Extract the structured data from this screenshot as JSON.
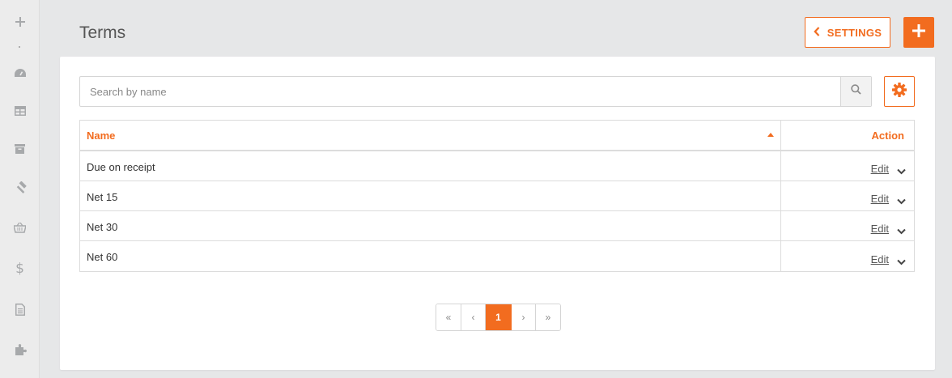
{
  "sidebar": {
    "items": [
      {
        "icon": "plus-icon"
      },
      {
        "icon": "dashboard-icon"
      },
      {
        "icon": "table-icon"
      },
      {
        "icon": "archive-icon"
      },
      {
        "icon": "hammer-icon"
      },
      {
        "icon": "basket-icon"
      },
      {
        "icon": "dollar-icon"
      },
      {
        "icon": "document-icon"
      },
      {
        "icon": "puzzle-icon"
      }
    ]
  },
  "header": {
    "title": "Terms",
    "settings_label": "SETTINGS",
    "add_icon": "plus-icon"
  },
  "search": {
    "placeholder": "Search by name",
    "value": ""
  },
  "table": {
    "columns": [
      "Name",
      "Action"
    ],
    "sort": {
      "column": "Name",
      "direction": "ascending"
    },
    "rows": [
      {
        "name": "Due on receipt",
        "action": "Edit"
      },
      {
        "name": "Net 15",
        "action": "Edit"
      },
      {
        "name": "Net 30",
        "action": "Edit"
      },
      {
        "name": "Net 60",
        "action": "Edit"
      }
    ]
  },
  "pagination": {
    "first": "«",
    "prev": "‹",
    "current": "1",
    "next": "›",
    "last": "»"
  },
  "colors": {
    "accent": "#f26c1f",
    "background": "#e6e7e8",
    "sidebar": "#ececec",
    "icon": "#a7a9ab"
  }
}
